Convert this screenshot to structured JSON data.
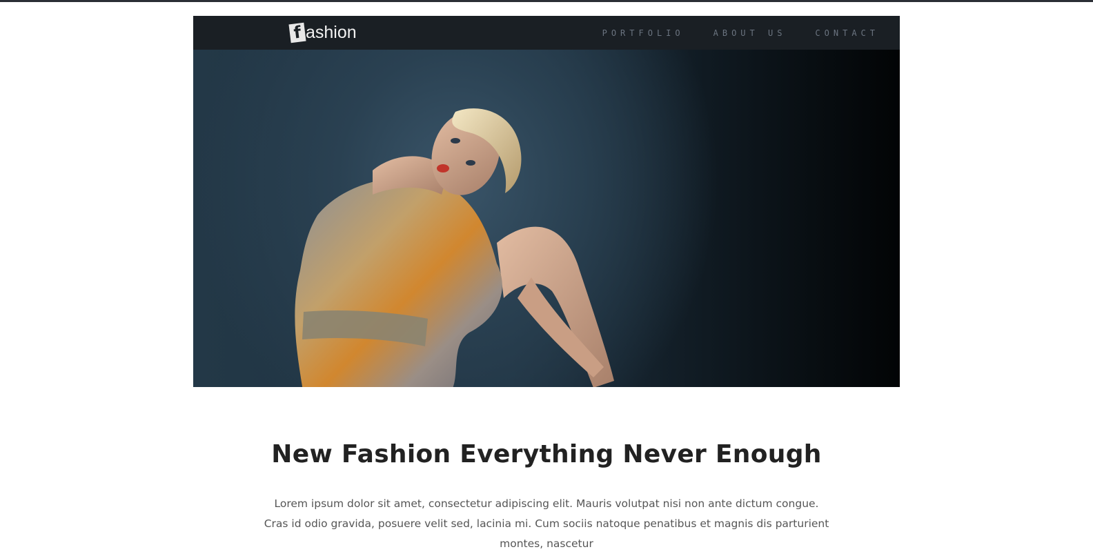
{
  "header": {
    "logo_mark": "f",
    "logo_text": "ashion",
    "nav": [
      {
        "label": "PORTFOLIO"
      },
      {
        "label": "ABOUT US"
      },
      {
        "label": "CONTACT"
      }
    ]
  },
  "hero": {
    "image": "fashion-model-photo"
  },
  "content": {
    "headline": "New Fashion Everything Never Enough",
    "body": "Lorem ipsum dolor sit amet, consectetur adipiscing elit. Mauris volutpat nisi non ante dictum congue. Cras id odio gravida, posuere velit sed, lacinia mi. Cum sociis natoque penatibus et magnis dis parturient montes, nascetur"
  },
  "colors": {
    "navbar": "#1a1f24",
    "nav_link": "#6b7480",
    "headline": "#222222",
    "body_text": "#555555"
  }
}
